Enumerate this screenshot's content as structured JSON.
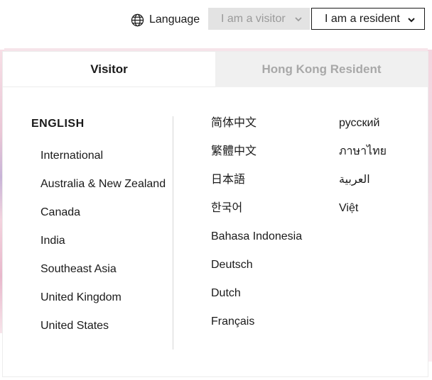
{
  "header": {
    "language_label": "Language",
    "visitor_select": "I am a visitor",
    "resident_select": "I am a resident"
  },
  "menu": {
    "tabs": [
      {
        "label": "Visitor",
        "active": true
      },
      {
        "label": "Hong Kong Resident",
        "active": false
      }
    ],
    "english_heading": "ENGLISH",
    "english_regions": [
      "International",
      "Australia & New Zealand",
      "Canada",
      "India",
      "Southeast Asia",
      "United Kingdom",
      "United States"
    ],
    "languages_col1": [
      "简体中文",
      "繁體中文",
      "日本語",
      "한국어",
      "Bahasa Indonesia",
      "Deutsch",
      "Dutch",
      "Français"
    ],
    "languages_col2": [
      "русский",
      "ภาษาไทย",
      "العربية",
      "Việt"
    ]
  },
  "icons": {
    "language": "globe-icon",
    "dropdown": "chevron-down-icon"
  },
  "colors": {
    "text": "#1a1a1a",
    "inactive_tab_bg": "#f0f0f0",
    "inactive_tab_text": "#a8a8a8",
    "visitor_select_bg": "#e3e3e3"
  }
}
